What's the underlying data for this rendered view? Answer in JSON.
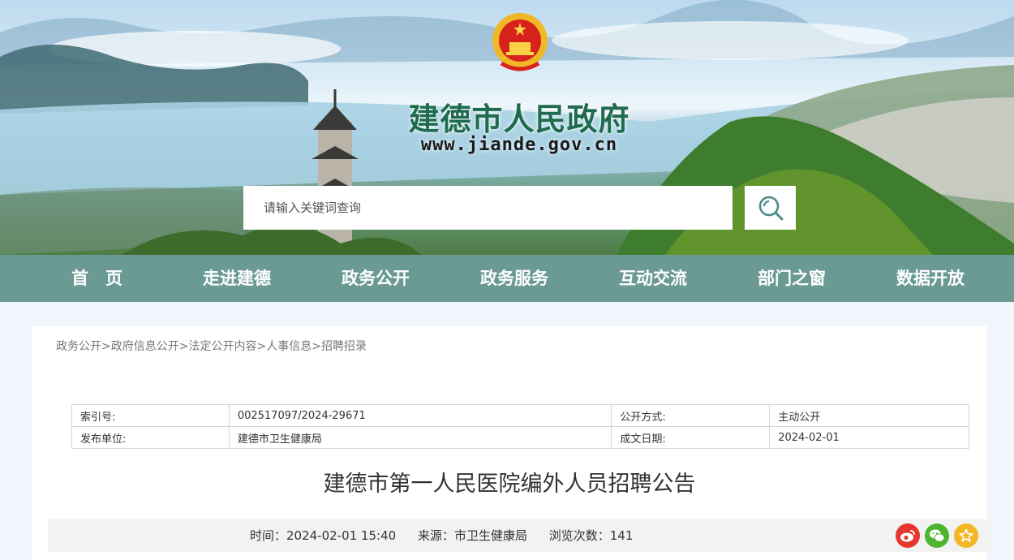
{
  "header": {
    "site_title": "建德市人民政府",
    "site_url": "www.jiande.gov.cn",
    "search_placeholder": "请输入关键词查询"
  },
  "nav": {
    "items": [
      {
        "label": "首　页"
      },
      {
        "label": "走进建德"
      },
      {
        "label": "政务公开"
      },
      {
        "label": "政务服务"
      },
      {
        "label": "互动交流"
      },
      {
        "label": "部门之窗"
      },
      {
        "label": "数据开放"
      }
    ]
  },
  "breadcrumb": {
    "items": [
      "政务公开",
      "政府信息公开",
      "法定公开内容",
      "人事信息",
      "招聘招录"
    ],
    "separator": ">"
  },
  "meta_table": {
    "index_label": "索引号:",
    "index_value": "002517097/2024-29671",
    "disclosure_label": "公开方式:",
    "disclosure_value": "主动公开",
    "publisher_label": "发布单位:",
    "publisher_value": "建德市卫生健康局",
    "date_label": "成文日期:",
    "date_value": "2024-02-01"
  },
  "article": {
    "title": "建德市第一人民医院编外人员招聘公告",
    "time": "时间：2024-02-01 15:40",
    "source": "来源：市卫生健康局",
    "views": "浏览次数：141"
  },
  "share": {
    "weibo_icon": "weibo-icon",
    "wechat_icon": "wechat-icon",
    "favorite_icon": "star-icon",
    "colors": {
      "weibo": "#e6372f",
      "wechat": "#4eb430",
      "favorite": "#f3b723"
    }
  },
  "theme": {
    "nav_bg": "#6b9a94",
    "title_green": "#1f6b4f"
  }
}
